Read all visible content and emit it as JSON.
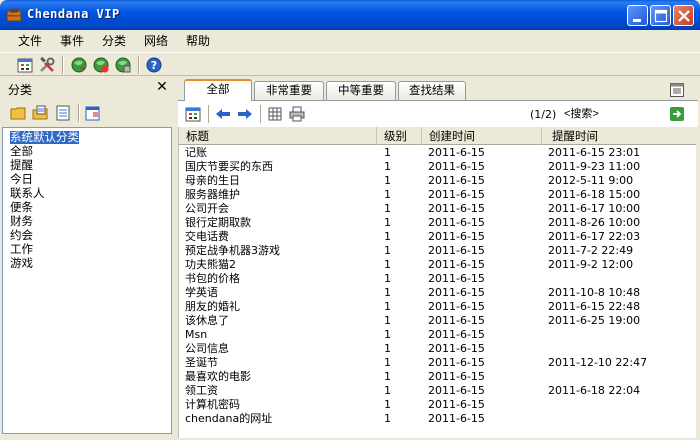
{
  "window": {
    "title": "Chendana VIP",
    "controls": {
      "minimize": "minimize",
      "maximize": "maximize",
      "close": "close"
    }
  },
  "menu": [
    {
      "label": "文件"
    },
    {
      "label": "事件"
    },
    {
      "label": "分类"
    },
    {
      "label": "网络"
    },
    {
      "label": "帮助"
    }
  ],
  "toolbar": {
    "icons": [
      "calendar-icon",
      "tools-icon",
      "globe-icon",
      "globe-icon-2",
      "globe-icon-3",
      "help-icon"
    ]
  },
  "left_panel": {
    "title": "分类",
    "close_glyph": "✕",
    "categories": [
      {
        "label": "系统默认分类",
        "selected": true
      },
      {
        "label": "全部"
      },
      {
        "label": "提醒"
      },
      {
        "label": "今日"
      },
      {
        "label": "联系人"
      },
      {
        "label": "便条"
      },
      {
        "label": "财务"
      },
      {
        "label": "约会"
      },
      {
        "label": "工作"
      },
      {
        "label": "游戏"
      }
    ]
  },
  "tabs": [
    {
      "label": "全部",
      "active": true
    },
    {
      "label": "非常重要"
    },
    {
      "label": "中等重要"
    },
    {
      "label": "查找结果"
    }
  ],
  "sub_toolbar": {
    "page": "(1/2)",
    "search_placeholder": "<搜索>"
  },
  "table": {
    "columns": [
      "标题",
      "级别",
      "创建时间",
      "提醒时间"
    ],
    "rows": [
      {
        "title": "记账",
        "level": "1",
        "created": "2011-6-15",
        "remind": "2011-6-15 23:01"
      },
      {
        "title": "国庆节要买的东西",
        "level": "1",
        "created": "2011-6-15",
        "remind": "2011-9-23 11:00"
      },
      {
        "title": "母亲的生日",
        "level": "1",
        "created": "2011-6-15",
        "remind": "2012-5-11 9:00"
      },
      {
        "title": "服务器维护",
        "level": "1",
        "created": "2011-6-15",
        "remind": "2011-6-18 15:00"
      },
      {
        "title": "公司开会",
        "level": "1",
        "created": "2011-6-15",
        "remind": "2011-6-17 10:00"
      },
      {
        "title": "银行定期取款",
        "level": "1",
        "created": "2011-6-15",
        "remind": "2011-8-26 10:00"
      },
      {
        "title": "交电话费",
        "level": "1",
        "created": "2011-6-15",
        "remind": "2011-6-17 22:03"
      },
      {
        "title": "预定战争机器3游戏",
        "level": "1",
        "created": "2011-6-15",
        "remind": "2011-7-2 22:49"
      },
      {
        "title": "功夫熊猫2",
        "level": "1",
        "created": "2011-6-15",
        "remind": "2011-9-2 12:00"
      },
      {
        "title": "书包的价格",
        "level": "1",
        "created": "2011-6-15",
        "remind": ""
      },
      {
        "title": "学英语",
        "level": "1",
        "created": "2011-6-15",
        "remind": "2011-10-8 10:48"
      },
      {
        "title": "朋友的婚礼",
        "level": "1",
        "created": "2011-6-15",
        "remind": "2011-6-15 22:48"
      },
      {
        "title": "该休息了",
        "level": "1",
        "created": "2011-6-15",
        "remind": "2011-6-25 19:00"
      },
      {
        "title": "Msn",
        "level": "1",
        "created": "2011-6-15",
        "remind": ""
      },
      {
        "title": "公司信息",
        "level": "1",
        "created": "2011-6-15",
        "remind": ""
      },
      {
        "title": "圣诞节",
        "level": "1",
        "created": "2011-6-15",
        "remind": "2011-12-10 22:47"
      },
      {
        "title": "最喜欢的电影",
        "level": "1",
        "created": "2011-6-15",
        "remind": ""
      },
      {
        "title": "领工资",
        "level": "1",
        "created": "2011-6-15",
        "remind": "2011-6-18 22:04"
      },
      {
        "title": "计算机密码",
        "level": "1",
        "created": "2011-6-15",
        "remind": ""
      },
      {
        "title": "chendana的网址",
        "level": "1",
        "created": "2011-6-15",
        "remind": ""
      }
    ]
  }
}
